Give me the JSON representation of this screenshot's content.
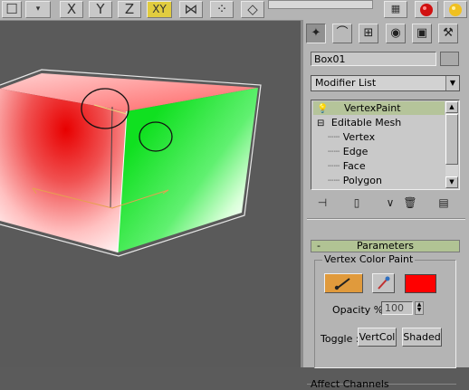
{
  "toolbar": {
    "buttons": [
      {
        "name": "select-icon",
        "glyph": "☐"
      },
      {
        "name": "x-axis-button",
        "glyph": "X"
      },
      {
        "name": "y-axis-button",
        "glyph": "Y"
      },
      {
        "name": "z-axis-button",
        "glyph": "Z"
      },
      {
        "name": "xy-axis-button",
        "glyph": "XY"
      },
      {
        "name": "mirror-icon",
        "glyph": "⋈"
      },
      {
        "name": "array-icon",
        "glyph": "⁘"
      },
      {
        "name": "align-icon",
        "glyph": "◇"
      }
    ],
    "right_icons": [
      "material-editor-icon",
      "render-teapot-icon"
    ]
  },
  "panel": {
    "tabs": [
      {
        "name": "create-tab",
        "glyph": "✦"
      },
      {
        "name": "modify-tab",
        "glyph": "⌒"
      },
      {
        "name": "hierarchy-tab",
        "glyph": "⊞"
      },
      {
        "name": "motion-tab",
        "glyph": "◉"
      },
      {
        "name": "display-tab",
        "glyph": "▣"
      },
      {
        "name": "utilities-tab",
        "glyph": "⚒"
      }
    ],
    "object_name": "Box01",
    "modifier_list": "Modifier List",
    "stack": {
      "selected": "VertexPaint",
      "base": "Editable Mesh",
      "subobjects": [
        "Vertex",
        "Edge",
        "Face",
        "Polygon"
      ]
    },
    "stack_tools": [
      "pin-stack-icon",
      "show-end-result-icon",
      "make-unique-icon",
      "remove-modifier-icon",
      "configure-sets-icon"
    ],
    "parameters": {
      "title": "Parameters",
      "collapse": "-",
      "group_label": "Vertex Color Paint",
      "paint_color": "#ff0000",
      "opacity_label": "Opacity % :",
      "opacity_value": "100",
      "toggle_label": "Toggle :",
      "vertcol_label": "VertCol",
      "shaded_label": "Shaded"
    },
    "next_rollout": "Affect Channels"
  },
  "colors": {
    "active_toolbar": "#e1cc3f",
    "selected_modifier": "#b5c49a",
    "paint_brush_active": "#e09a3c"
  }
}
